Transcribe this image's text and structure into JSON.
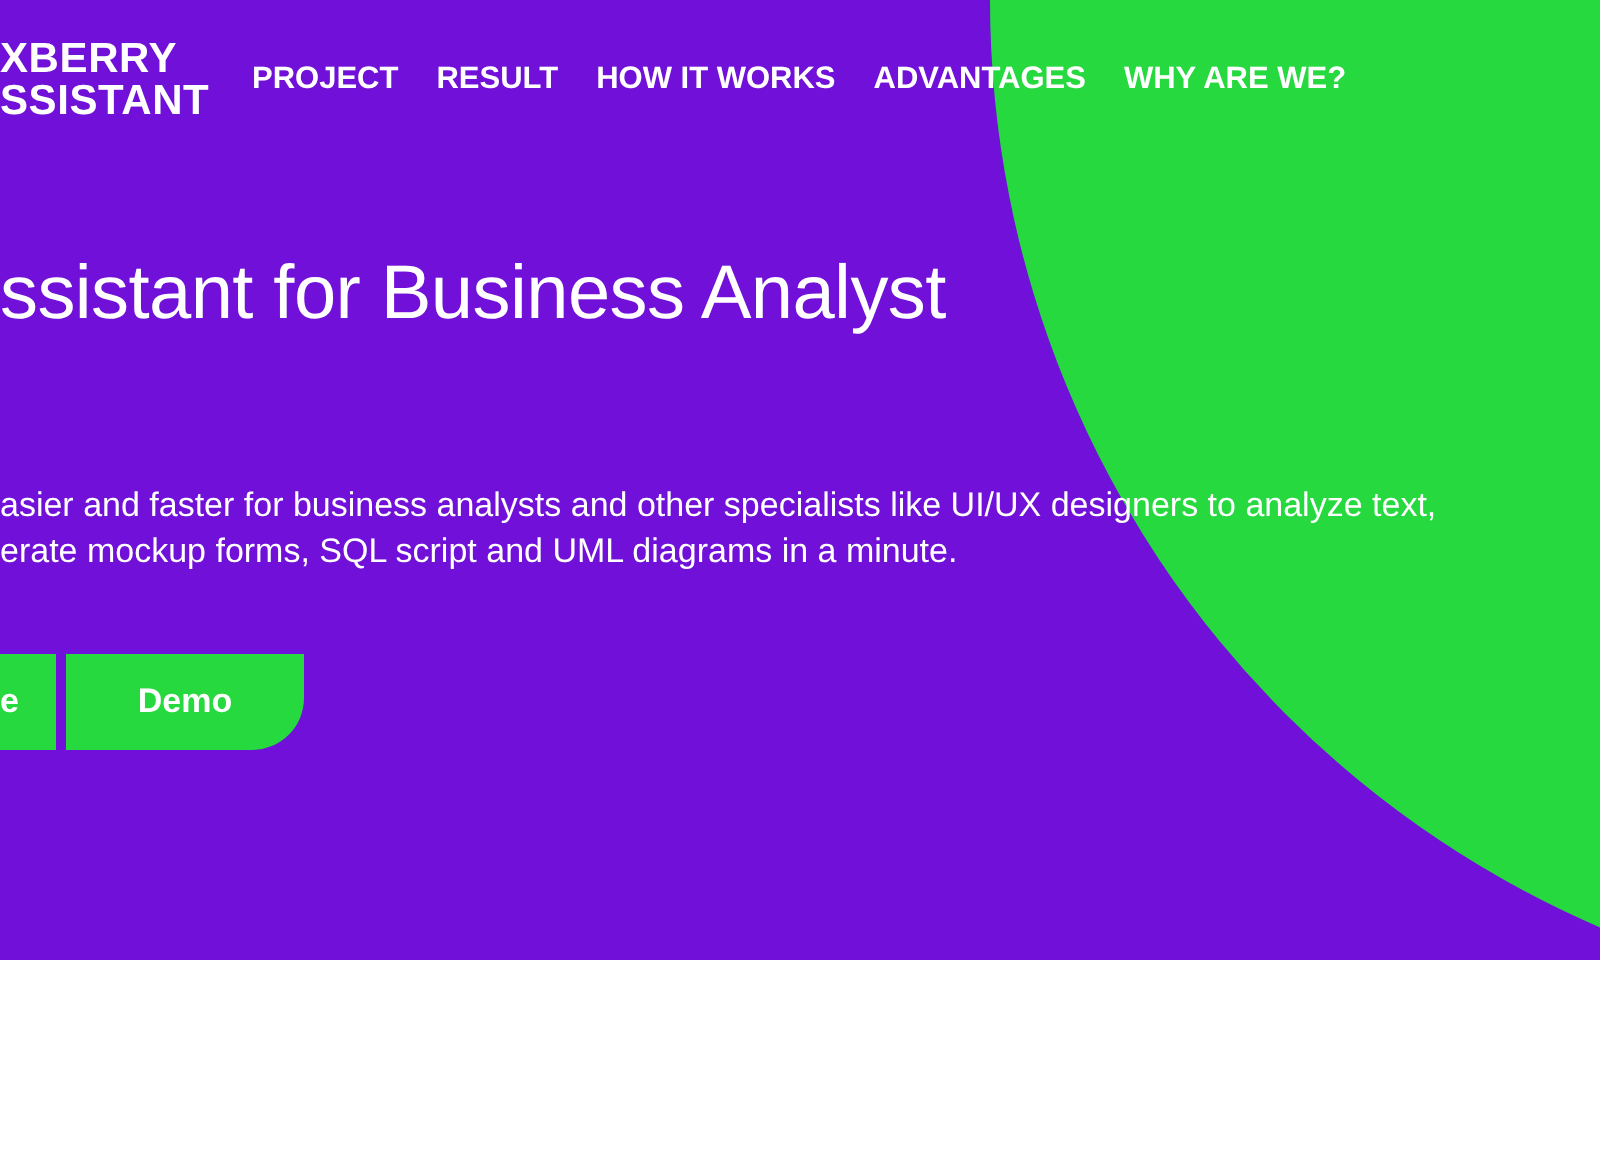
{
  "brand": {
    "lines": [
      "XBERRY",
      "SSISTANT"
    ]
  },
  "nav": [
    {
      "label": "PROJECT"
    },
    {
      "label": "RESULT"
    },
    {
      "label": "HOW IT WORKS"
    },
    {
      "label": "ADVANTAGES"
    },
    {
      "label": "WHY ARE WE?"
    }
  ],
  "hero": {
    "title": "ssistant for Business Analyst",
    "description": [
      "asier and faster for business analysts and other specialists like UI/UX designers to analyze text,",
      "erate mockup forms, SQL script and UML diagrams in a minute."
    ],
    "buttons": [
      {
        "label": "e"
      },
      {
        "label": "Demo"
      }
    ]
  }
}
